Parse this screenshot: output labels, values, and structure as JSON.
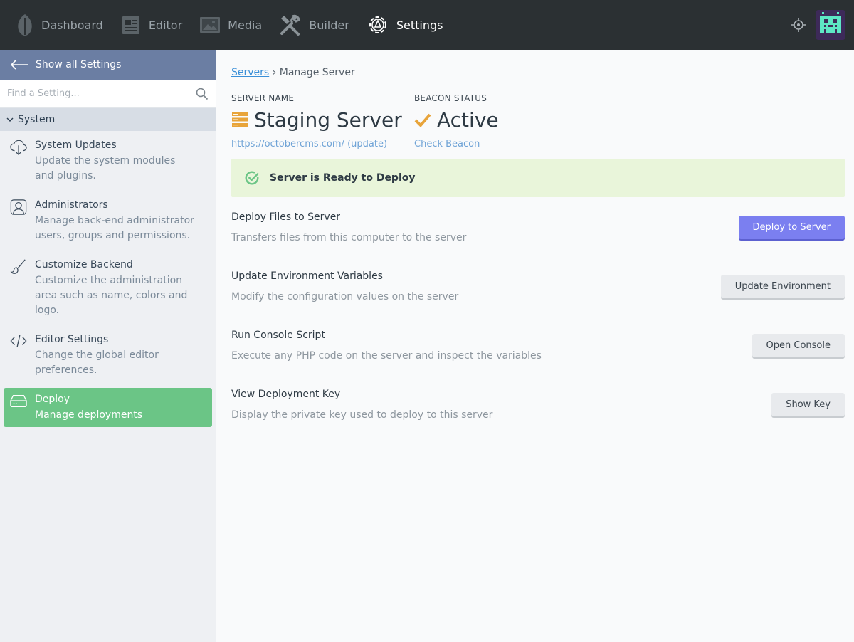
{
  "nav": {
    "items": [
      {
        "label": "Dashboard",
        "icon": "leaf-icon"
      },
      {
        "label": "Editor",
        "icon": "editor-icon"
      },
      {
        "label": "Media",
        "icon": "media-icon"
      },
      {
        "label": "Builder",
        "icon": "builder-icon"
      },
      {
        "label": "Settings",
        "icon": "settings-icon",
        "active": true
      }
    ],
    "right": {
      "locate_icon": "crosshair-icon",
      "avatar_icon": "pixel-monster-avatar"
    }
  },
  "sidebar": {
    "back_label": "Show all Settings",
    "search_placeholder": "Find a Setting...",
    "group_label": "System",
    "items": [
      {
        "title": "System Updates",
        "desc": "Update the system modules and plugins.",
        "icon": "cloud-download-icon"
      },
      {
        "title": "Administrators",
        "desc": "Manage back-end administrator users, groups and permissions.",
        "icon": "user-portrait-icon"
      },
      {
        "title": "Customize Backend",
        "desc": "Customize the administration area such as name, colors and logo.",
        "icon": "brush-icon"
      },
      {
        "title": "Editor Settings",
        "desc": "Change the global editor preferences.",
        "icon": "code-icon"
      },
      {
        "title": "Deploy",
        "desc": "Manage deployments",
        "icon": "hard-drive-icon",
        "active": true
      }
    ]
  },
  "main": {
    "breadcrumb": {
      "link": "Servers",
      "separator": "›",
      "current": "Manage Server"
    },
    "server": {
      "label": "SERVER NAME",
      "name": "Staging Server",
      "url": "https://octobercms.com/",
      "update_link": "(update)"
    },
    "beacon": {
      "label": "BEACON STATUS",
      "status": "Active",
      "link": "Check Beacon"
    },
    "ready_message": "Server is Ready to Deploy",
    "actions": [
      {
        "title": "Deploy Files to Server",
        "desc": "Transfers files from this computer to the server",
        "button": "Deploy to Server",
        "primary": true
      },
      {
        "title": "Update Environment Variables",
        "desc": "Modify the configuration values on the server",
        "button": "Update Environment"
      },
      {
        "title": "Run Console Script",
        "desc": "Execute any PHP code on the server and inspect the variables",
        "button": "Open Console"
      },
      {
        "title": "View Deployment Key",
        "desc": "Display the private key used to deploy to this server",
        "button": "Show Key"
      }
    ]
  },
  "colors": {
    "topbar": "#2b3033",
    "sidebar_back": "#6b7ea3",
    "active_item": "#6bc586",
    "ready_bg": "#e9f5da",
    "primary_button": "#7b7ff0",
    "status_icon": "#e8a43a"
  }
}
